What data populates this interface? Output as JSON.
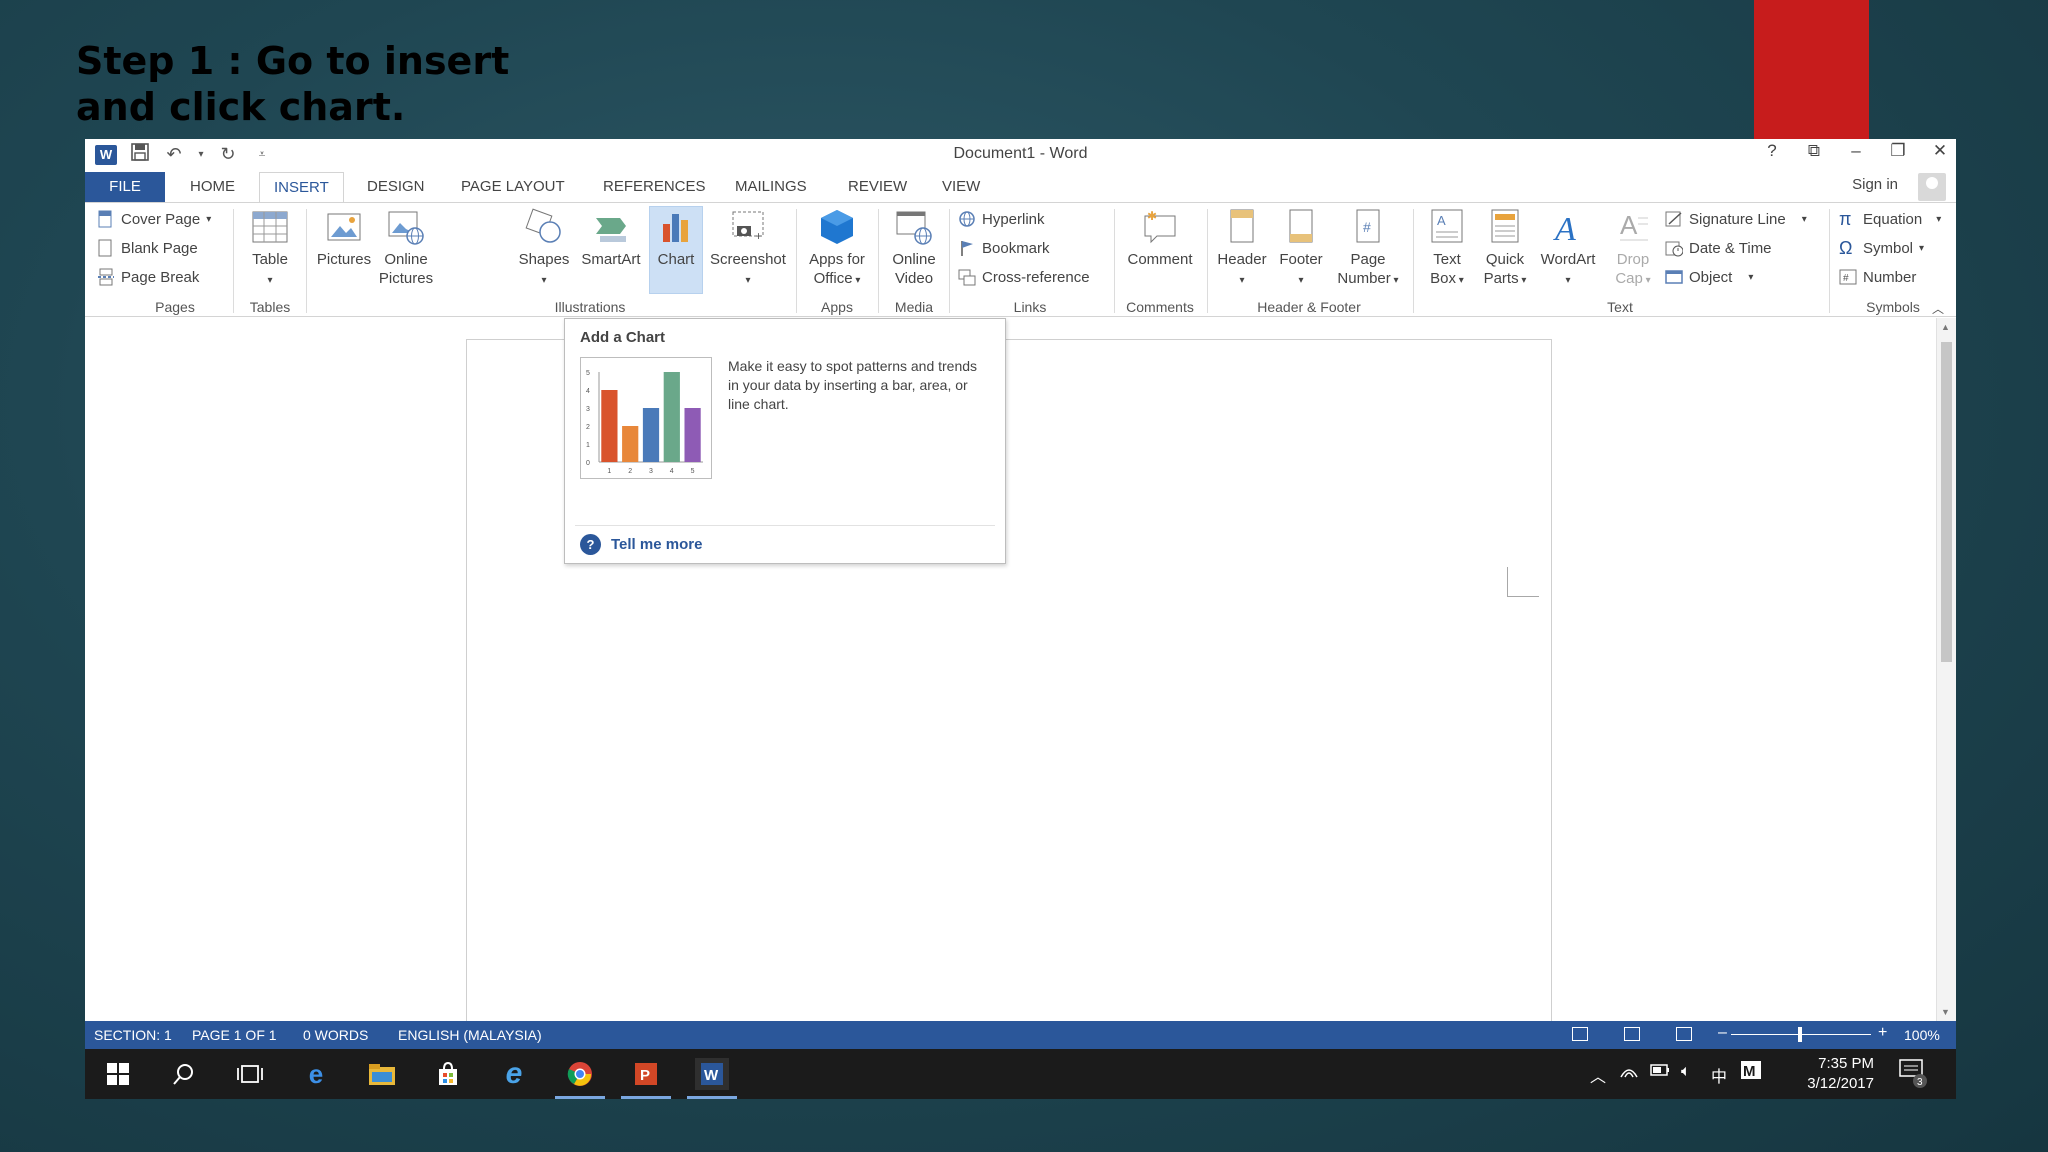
{
  "slide": {
    "title_line1": "Step 1 : Go to insert",
    "title_line2": "and click chart."
  },
  "window": {
    "title": "Document1 - Word",
    "controls": [
      "?",
      "⧉",
      "–",
      "❐",
      "✕"
    ]
  },
  "tabs": [
    {
      "label": "FILE"
    },
    {
      "label": "HOME"
    },
    {
      "label": "INSERT",
      "active": true
    },
    {
      "label": "DESIGN"
    },
    {
      "label": "PAGE LAYOUT"
    },
    {
      "label": "REFERENCES"
    },
    {
      "label": "MAILINGS"
    },
    {
      "label": "REVIEW"
    },
    {
      "label": "VIEW"
    }
  ],
  "account": {
    "sign_in": "Sign in"
  },
  "ribbon": {
    "pages": {
      "label": "Pages",
      "cover_page": "Cover Page",
      "blank_page": "Blank Page",
      "page_break": "Page Break"
    },
    "tables": {
      "label": "Tables",
      "table": "Table"
    },
    "illustrations": {
      "label": "Illustrations",
      "pictures": "Pictures",
      "online_pictures_1": "Online",
      "online_pictures_2": "Pictures",
      "shapes": "Shapes",
      "smartart": "SmartArt",
      "chart": "Chart",
      "screenshot": "Screenshot"
    },
    "apps": {
      "label": "Apps",
      "apps_for_office_1": "Apps for",
      "apps_for_office_2": "Office"
    },
    "media": {
      "label": "Media",
      "online_video_1": "Online",
      "online_video_2": "Video"
    },
    "links": {
      "label": "Links",
      "hyperlink": "Hyperlink",
      "bookmark": "Bookmark",
      "cross_reference": "Cross-reference"
    },
    "comments": {
      "label": "Comments",
      "comment": "Comment"
    },
    "header_footer": {
      "label": "Header & Footer",
      "header": "Header",
      "footer": "Footer",
      "page_number_1": "Page",
      "page_number_2": "Number"
    },
    "text": {
      "label": "Text",
      "text_box_1": "Text",
      "text_box_2": "Box",
      "quick_parts_1": "Quick",
      "quick_parts_2": "Parts",
      "wordart": "WordArt",
      "drop_cap_1": "Drop",
      "drop_cap_2": "Cap",
      "signature_line": "Signature Line",
      "date_time": "Date & Time",
      "object": "Object"
    },
    "symbols": {
      "label": "Symbols",
      "equation": "Equation",
      "symbol": "Symbol",
      "number": "Number"
    }
  },
  "tooltip": {
    "title": "Add a Chart",
    "description": "Make it easy to spot patterns and trends in your data by inserting a bar, area, or line chart.",
    "link": "Tell me more"
  },
  "chart_data": {
    "type": "bar",
    "categories": [
      "1",
      "2",
      "3",
      "4",
      "5"
    ],
    "values": [
      4,
      2,
      3,
      5,
      3
    ],
    "colors": [
      "#d9532c",
      "#e8873a",
      "#4a7ab9",
      "#6aa88a",
      "#8e5bb5"
    ],
    "yticks": [
      "0",
      "1",
      "2",
      "3",
      "4",
      "5"
    ],
    "ylim": [
      0,
      5
    ]
  },
  "status": {
    "section": "SECTION: 1",
    "page": "PAGE 1 OF 1",
    "words": "0 WORDS",
    "language": "ENGLISH (MALAYSIA)",
    "zoom": "100%",
    "zoom_minus": "–",
    "zoom_plus": "+"
  },
  "taskbar": {
    "time": "7:35 PM",
    "date": "3/12/2017",
    "ime": "中",
    "notification_count": "3"
  }
}
